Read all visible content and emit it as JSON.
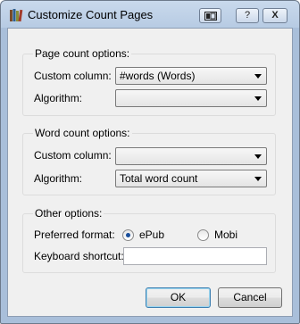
{
  "window": {
    "title": "Customize Count Pages",
    "icon": "books-icon",
    "controls": {
      "restore_label": "▭",
      "help_label": "?",
      "close_label": "X"
    }
  },
  "page_count": {
    "legend": "Page count options:",
    "custom_column_label": "Custom column:",
    "custom_column_value": "#words (Words)",
    "algorithm_label": "Algorithm:",
    "algorithm_value": ""
  },
  "word_count": {
    "legend": "Word count options:",
    "custom_column_label": "Custom column:",
    "custom_column_value": "",
    "algorithm_label": "Algorithm:",
    "algorithm_value": "Total word count"
  },
  "other": {
    "legend": "Other options:",
    "preferred_format_label": "Preferred format:",
    "formats": [
      {
        "label": "ePub",
        "selected": true
      },
      {
        "label": "Mobi",
        "selected": false
      }
    ],
    "keyboard_shortcut_label": "Keyboard shortcut:",
    "keyboard_shortcut_value": ""
  },
  "buttons": {
    "ok_label": "OK",
    "cancel_label": "Cancel"
  }
}
